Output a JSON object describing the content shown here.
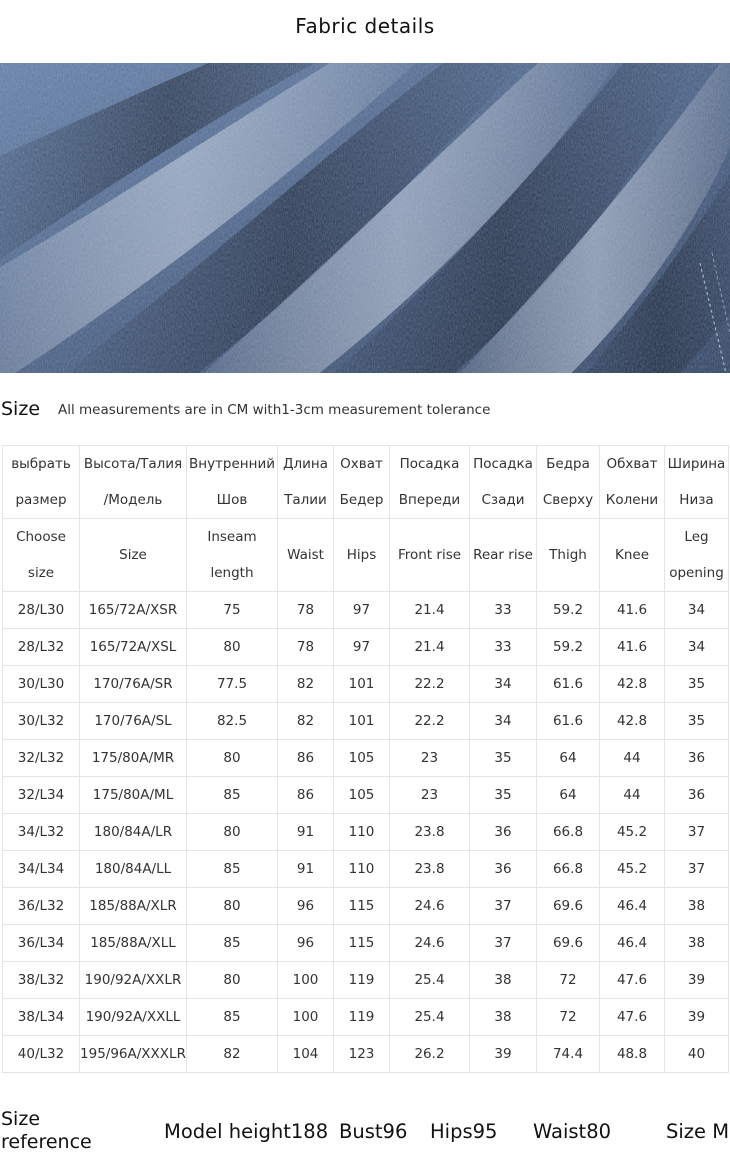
{
  "page": {
    "title": "Fabric details"
  },
  "size_section": {
    "heading": "Size",
    "note": "All measurements are in CM with1-3cm measurement tolerance"
  },
  "table": {
    "header_ru": [
      [
        "выбрать",
        "размер"
      ],
      [
        "Высота/Талия",
        "/Модель"
      ],
      [
        "Внутренний",
        "Шов"
      ],
      [
        "Длина",
        "Талии"
      ],
      [
        "Охват",
        "Бедер"
      ],
      [
        "Посадка",
        "Впереди"
      ],
      [
        "Посадка",
        "Сзади"
      ],
      [
        "Бедра",
        "Сверху"
      ],
      [
        "Обхват",
        "Колени"
      ],
      [
        "Ширина",
        "Низа"
      ]
    ],
    "header_en": [
      [
        "Choose",
        "size"
      ],
      [
        "Size"
      ],
      [
        "Inseam",
        "length"
      ],
      [
        "Waist"
      ],
      [
        "Hips"
      ],
      [
        "Front rise"
      ],
      [
        "Rear rise"
      ],
      [
        "Thigh"
      ],
      [
        "Knee"
      ],
      [
        "Leg",
        "opening"
      ]
    ],
    "rows": [
      [
        "28/L30",
        "165/72A/XSR",
        "75",
        "78",
        "97",
        "21.4",
        "33",
        "59.2",
        "41.6",
        "34"
      ],
      [
        "28/L32",
        "165/72A/XSL",
        "80",
        "78",
        "97",
        "21.4",
        "33",
        "59.2",
        "41.6",
        "34"
      ],
      [
        "30/L30",
        "170/76A/SR",
        "77.5",
        "82",
        "101",
        "22.2",
        "34",
        "61.6",
        "42.8",
        "35"
      ],
      [
        "30/L32",
        "170/76A/SL",
        "82.5",
        "82",
        "101",
        "22.2",
        "34",
        "61.6",
        "42.8",
        "35"
      ],
      [
        "32/L32",
        "175/80A/MR",
        "80",
        "86",
        "105",
        "23",
        "35",
        "64",
        "44",
        "36"
      ],
      [
        "32/L34",
        "175/80A/ML",
        "85",
        "86",
        "105",
        "23",
        "35",
        "64",
        "44",
        "36"
      ],
      [
        "34/L32",
        "180/84A/LR",
        "80",
        "91",
        "110",
        "23.8",
        "36",
        "66.8",
        "45.2",
        "37"
      ],
      [
        "34/L34",
        "180/84A/LL",
        "85",
        "91",
        "110",
        "23.8",
        "36",
        "66.8",
        "45.2",
        "37"
      ],
      [
        "36/L32",
        "185/88A/XLR",
        "80",
        "96",
        "115",
        "24.6",
        "37",
        "69.6",
        "46.4",
        "38"
      ],
      [
        "36/L34",
        "185/88A/XLL",
        "85",
        "96",
        "115",
        "24.6",
        "37",
        "69.6",
        "46.4",
        "38"
      ],
      [
        "38/L32",
        "190/92A/XXLR",
        "80",
        "100",
        "119",
        "25.4",
        "38",
        "72",
        "47.6",
        "39"
      ],
      [
        "38/L34",
        "190/92A/XXLL",
        "85",
        "100",
        "119",
        "25.4",
        "38",
        "72",
        "47.6",
        "39"
      ],
      [
        "40/L32",
        "195/96A/XXXLR",
        "82",
        "104",
        "123",
        "26.2",
        "39",
        "74.4",
        "48.8",
        "40"
      ]
    ]
  },
  "reference": {
    "label_line1": "Size",
    "label_line2": "reference",
    "model_height": "Model height188",
    "bust": "Bust96",
    "hips": "Hips95",
    "waist": "Waist80",
    "size": "Size M"
  },
  "colors": {
    "denim_dark": "#2c4466",
    "denim_mid": "#56709a",
    "denim_light": "#9fb0c8",
    "grid_line": "#e4e4e4"
  }
}
